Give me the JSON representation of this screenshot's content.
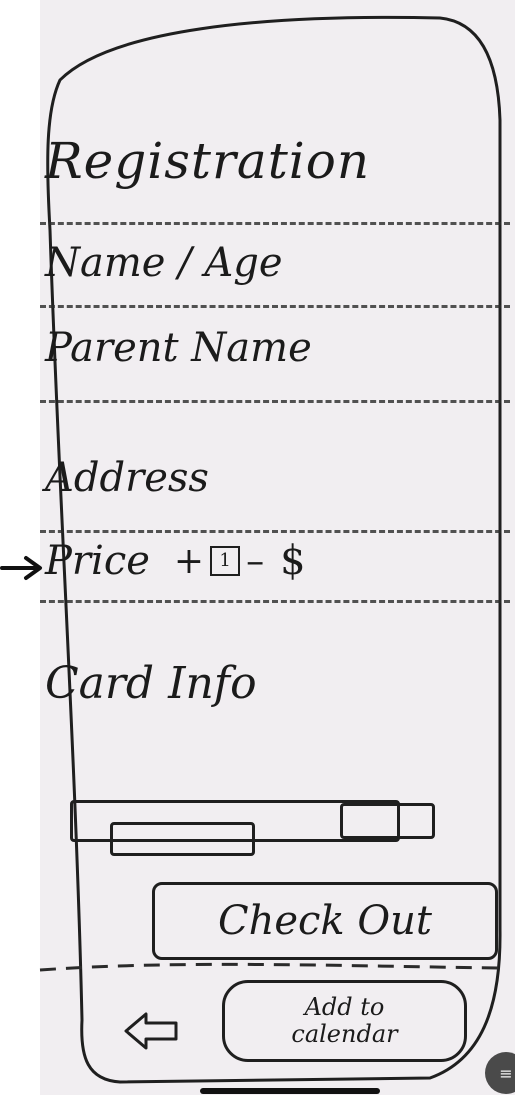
{
  "screen": {
    "title": "Registration",
    "fields": {
      "name_age": "Name / Age",
      "parent_name": "Parent Name",
      "address": "Address",
      "price_label": "Price",
      "price_plus": "+",
      "quantity": "1",
      "price_minus": "–",
      "price_currency": "$",
      "card_info": "Card Info"
    },
    "buttons": {
      "checkout": "Check Out",
      "add_to_calendar_line1": "Add to",
      "add_to_calendar_line2": "calendar"
    },
    "icons": {
      "back": "back-arrow-icon",
      "pointer": "right-arrow-icon",
      "corner": "document-icon"
    },
    "corner_badge_glyph": "≡"
  },
  "colors": {
    "paper": "#f1eef1",
    "ink": "#1b1b1b"
  }
}
